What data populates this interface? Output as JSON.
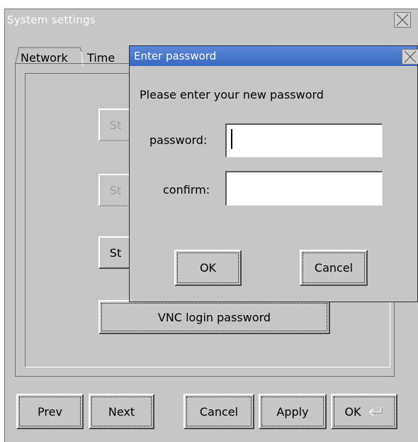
{
  "main_window": {
    "title": "System settings",
    "tabs": [
      "Network",
      "Time"
    ],
    "panel_buttons": {
      "hidden_1": "St",
      "hidden_2": "St",
      "hidden_3": "St",
      "vnc": "VNC login password"
    },
    "footer": {
      "prev": "Prev",
      "next": "Next",
      "cancel": "Cancel",
      "apply": "Apply",
      "ok": "OK"
    }
  },
  "dialog": {
    "title": "Enter password",
    "prompt": "Please enter your new password",
    "password_label": "password:",
    "password_value": "",
    "confirm_label": "confirm:",
    "confirm_value": "",
    "ok": "OK",
    "cancel": "Cancel"
  }
}
